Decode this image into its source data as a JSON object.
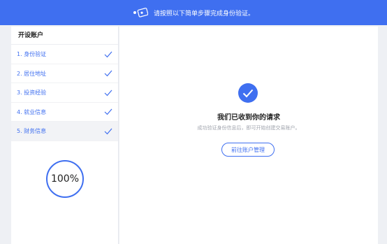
{
  "banner": {
    "icon": "id-card-icon",
    "text": "请按照以下简单步骤完成身份验证。"
  },
  "sidebar": {
    "title": "开设账户",
    "steps": [
      {
        "label": "1. 身份验证",
        "status": "complete"
      },
      {
        "label": "2. 居住地址",
        "status": "complete"
      },
      {
        "label": "3. 投资经验",
        "status": "complete"
      },
      {
        "label": "4. 就业信息",
        "status": "complete"
      },
      {
        "label": "5. 财务信息",
        "status": "complete"
      }
    ],
    "progress": "100%"
  },
  "main": {
    "icon": "check-circle-icon",
    "headline": "我们已收到你的请求",
    "subtext": "成功验证身份信息后，即可开始创建交易账户。",
    "button_label": "前往账户管理"
  },
  "colors": {
    "accent": "#3f6ff0",
    "background": "#eef0f4"
  }
}
